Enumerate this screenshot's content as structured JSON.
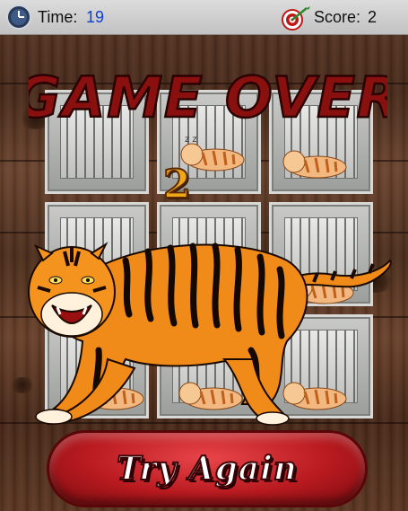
{
  "hud": {
    "time_label": "Time:",
    "time_value": "19",
    "score_label": "Score:",
    "score_value": "2",
    "time_icon": "clock-icon",
    "score_icon": "dartboard-icon"
  },
  "overlay": {
    "title": "GAME OVER",
    "final_score": "2",
    "title_color": "#8a1010",
    "score_color": "#f0a818"
  },
  "board": {
    "rows": 3,
    "cols": 3,
    "cage_contents": [
      "empty",
      "sleeping-tiger",
      "sleeping-tiger",
      "empty",
      "empty",
      "sleeping-tiger",
      "sleeping-tiger",
      "sleeping-tiger",
      "sleeping-tiger"
    ],
    "sleep_mark": "z z z"
  },
  "button": {
    "label": "Try Again",
    "color": "#c8202a"
  }
}
